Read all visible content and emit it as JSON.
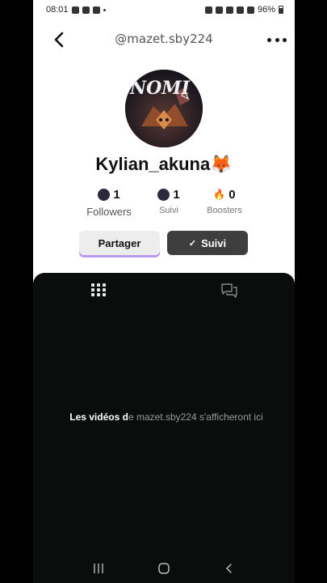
{
  "status_bar": {
    "time": "08:01",
    "battery": "96%"
  },
  "header": {
    "title": "@mazet.sby224"
  },
  "profile": {
    "display_name": "Kylian_akuna🦊",
    "avatar_text": "NOMI"
  },
  "stats": {
    "followers": {
      "value": "1",
      "label": "Followers"
    },
    "following": {
      "value": "1",
      "label": "Suivi"
    },
    "boosters": {
      "value": "0",
      "label": "Boosters",
      "icon": "🔥"
    }
  },
  "actions": {
    "share_label": "Partager",
    "following_label": "Suivi",
    "following_check": "✓"
  },
  "content": {
    "empty_strong": "Les vidéos d",
    "empty_rest": "e mazet.sby224 s'afficheront ici"
  },
  "colors": {
    "accent_shadow": "#b59cf0",
    "panel": "#0b0d0c",
    "follow_btn": "#3e3e3e"
  }
}
